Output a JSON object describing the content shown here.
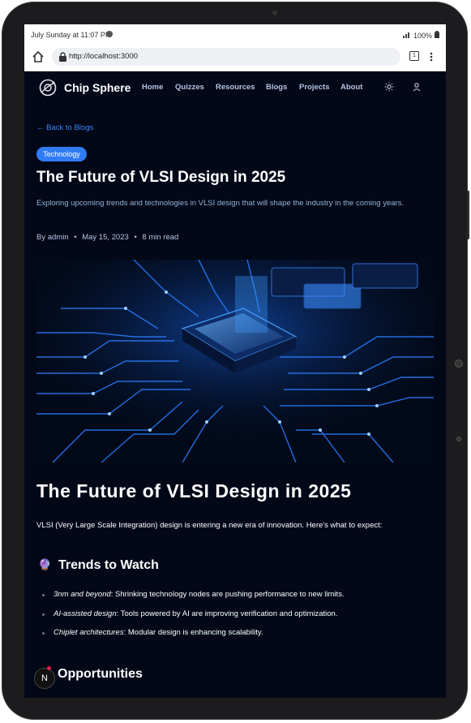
{
  "status_bar": {
    "time": "July Sunday at 11:07 PM",
    "battery": "100%"
  },
  "browser": {
    "url": "http://localhost:3000",
    "tab_count": "1"
  },
  "nav": {
    "brand": "Chip Sphere",
    "links": [
      "Home",
      "Quizzes",
      "Resources",
      "Blogs",
      "Projects",
      "About"
    ],
    "icons": [
      "sun-icon",
      "user-icon"
    ]
  },
  "post": {
    "back_link": "← Back to Blogs",
    "tag": "Technology",
    "title": "The Future of VLSI Design in 2025",
    "excerpt": "Exploring upcoming trends and technologies in VLSI design that will shape the industry in the coming years.",
    "author": "By admin",
    "date": "May 15, 2023",
    "read_time": "8 min read",
    "separator": "•"
  },
  "article": {
    "heading": "The Future of VLSI Design in 2025",
    "intro": "VLSI (Very Large Scale Integration) design is entering a new era of innovation. Here's what to expect:",
    "section1": {
      "emoji": "🔮",
      "heading": "Trends to Watch",
      "bullets": [
        {
          "term": "3nm and beyond",
          "text": ": Shrinking technology nodes are pushing performance to new limits."
        },
        {
          "term": "AI-assisted design",
          "text": ": Tools powered by AI are improving verification and optimization."
        },
        {
          "term": "Chiplet architectures",
          "text": ": Modular design is enhancing scalability."
        }
      ]
    },
    "section2": {
      "emoji": "🚀",
      "heading": "Opportunities"
    }
  },
  "dev_badge": "N",
  "colors": {
    "background": "#030818",
    "accent": "#2f7cf6",
    "excerpt": "#93b3d6",
    "nav_link": "#b6c4e2"
  }
}
